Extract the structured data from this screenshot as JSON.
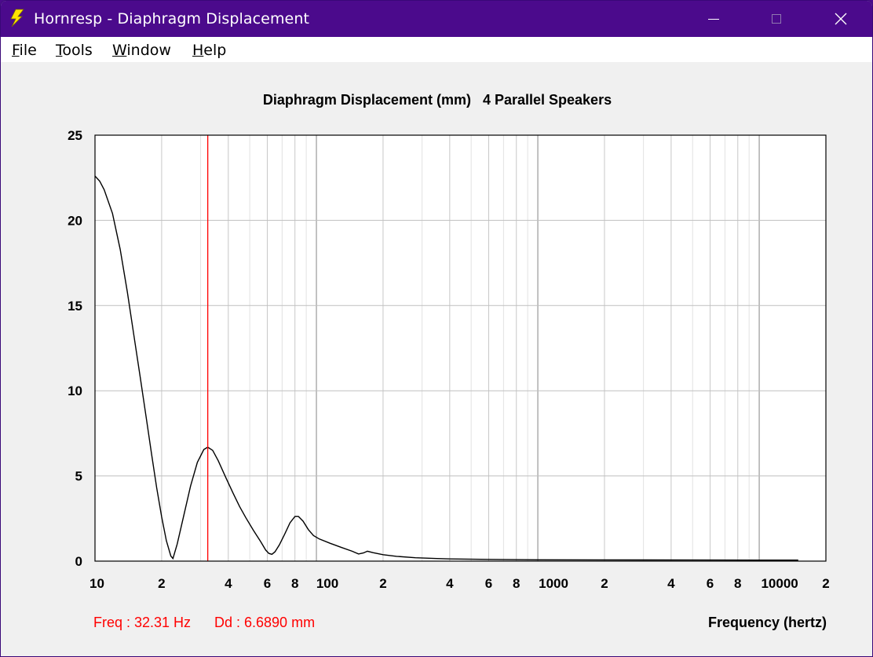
{
  "window": {
    "title": "Hornresp - Diaphragm Displacement",
    "controls": {
      "minimize": "minimize-icon",
      "maximize": "maximize-icon",
      "close": "close-icon"
    }
  },
  "menu": {
    "items": [
      {
        "label": "File"
      },
      {
        "label": "Tools"
      },
      {
        "label": "Window"
      },
      {
        "label": "Help"
      }
    ]
  },
  "readout": {
    "freq": "Freq : 32.31 Hz",
    "dd": "Dd : 6.6890 mm"
  },
  "colors": {
    "titlebar": "#4b0a8c",
    "plot_line": "#000000",
    "marker": "#ff0000",
    "grid": "#c8c8c8"
  },
  "chart_data": {
    "type": "line",
    "title": "Diaphragm Displacement (mm)",
    "subtitle": "4 Parallel Speakers",
    "xlabel": "Frequency (hertz)",
    "ylabel": "",
    "x_scale": "log",
    "xlim": [
      10,
      20000
    ],
    "ylim": [
      0,
      25
    ],
    "grid": true,
    "yticks": [
      "0",
      "5",
      "10",
      "15",
      "20",
      "25"
    ],
    "xticks": [
      {
        "value": 10,
        "label": "10"
      },
      {
        "value": 20,
        "label": "2"
      },
      {
        "value": 40,
        "label": "4"
      },
      {
        "value": 60,
        "label": "6"
      },
      {
        "value": 80,
        "label": "8"
      },
      {
        "value": 100,
        "label": "100"
      },
      {
        "value": 200,
        "label": "2"
      },
      {
        "value": 400,
        "label": "4"
      },
      {
        "value": 600,
        "label": "6"
      },
      {
        "value": 800,
        "label": "8"
      },
      {
        "value": 1000,
        "label": "1000"
      },
      {
        "value": 2000,
        "label": "2"
      },
      {
        "value": 4000,
        "label": "4"
      },
      {
        "value": 6000,
        "label": "6"
      },
      {
        "value": 8000,
        "label": "8"
      },
      {
        "value": 10000,
        "label": "10000"
      },
      {
        "value": 20000,
        "label": "2"
      }
    ],
    "marker": {
      "x": 32.31,
      "y": 6.689
    },
    "series": [
      {
        "points": [
          [
            10,
            22.6
          ],
          [
            10.5,
            22.3
          ],
          [
            11,
            21.8
          ],
          [
            12,
            20.4
          ],
          [
            13,
            18.3
          ],
          [
            14,
            15.8
          ],
          [
            15,
            13.2
          ],
          [
            16,
            10.8
          ],
          [
            17,
            8.5
          ],
          [
            18,
            6.3
          ],
          [
            19,
            4.3
          ],
          [
            20,
            2.6
          ],
          [
            21,
            1.2
          ],
          [
            22,
            0.3
          ],
          [
            22.5,
            0.15
          ],
          [
            23.5,
            1.0
          ],
          [
            25,
            2.5
          ],
          [
            27,
            4.4
          ],
          [
            29,
            5.8
          ],
          [
            31,
            6.55
          ],
          [
            32.31,
            6.69
          ],
          [
            34,
            6.5
          ],
          [
            36,
            5.9
          ],
          [
            39,
            4.9
          ],
          [
            42,
            4.0
          ],
          [
            45,
            3.2
          ],
          [
            48,
            2.55
          ],
          [
            52,
            1.8
          ],
          [
            56,
            1.15
          ],
          [
            59,
            0.65
          ],
          [
            61,
            0.45
          ],
          [
            63,
            0.4
          ],
          [
            65,
            0.55
          ],
          [
            68,
            0.95
          ],
          [
            72,
            1.6
          ],
          [
            76,
            2.25
          ],
          [
            80,
            2.62
          ],
          [
            83,
            2.62
          ],
          [
            87,
            2.35
          ],
          [
            92,
            1.85
          ],
          [
            97,
            1.5
          ],
          [
            103,
            1.3
          ],
          [
            115,
            1.05
          ],
          [
            130,
            0.8
          ],
          [
            145,
            0.58
          ],
          [
            155,
            0.42
          ],
          [
            163,
            0.48
          ],
          [
            170,
            0.58
          ],
          [
            180,
            0.5
          ],
          [
            200,
            0.38
          ],
          [
            230,
            0.28
          ],
          [
            280,
            0.2
          ],
          [
            350,
            0.15
          ],
          [
            400,
            0.13
          ],
          [
            600,
            0.1
          ],
          [
            1000,
            0.08
          ],
          [
            3000,
            0.07
          ],
          [
            10000,
            0.06
          ],
          [
            15000,
            0.06
          ]
        ]
      }
    ]
  }
}
